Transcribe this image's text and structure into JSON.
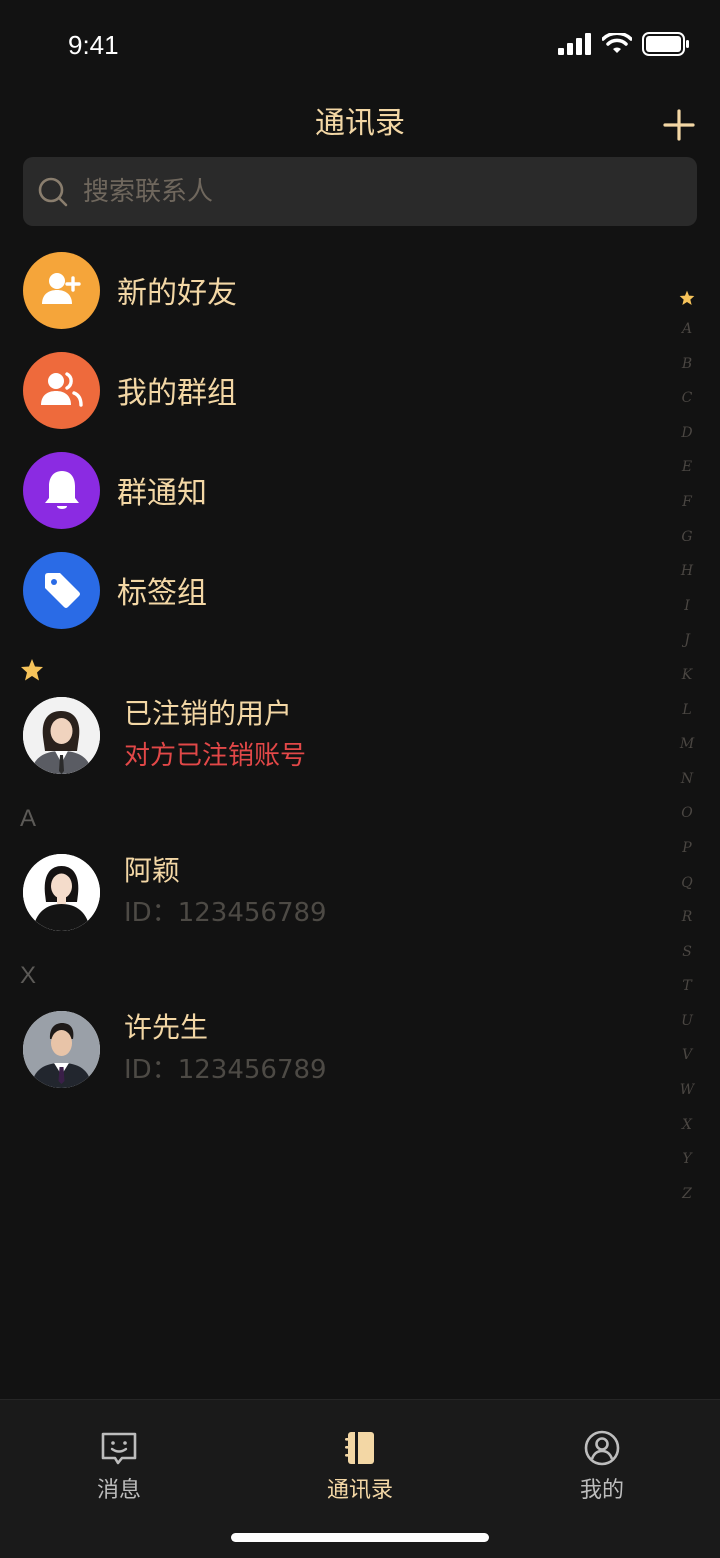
{
  "status": {
    "time": "9:41"
  },
  "header": {
    "title": "通讯录"
  },
  "search": {
    "placeholder": "搜索联系人"
  },
  "menu": [
    {
      "label": "新的好友",
      "color": "#F5A53A",
      "icon": "add-friend-icon"
    },
    {
      "label": "我的群组",
      "color": "#EE6A3C",
      "icon": "group-icon"
    },
    {
      "label": "群通知",
      "color": "#8B2BE2",
      "icon": "bell-icon"
    },
    {
      "label": "标签组",
      "color": "#2A6BE6",
      "icon": "tag-icon"
    }
  ],
  "sections": {
    "star": "★",
    "a": "A",
    "x": "X"
  },
  "contacts": [
    {
      "name": "已注销的用户",
      "sub": "对方已注销账号",
      "status": "deactivated"
    },
    {
      "name": "阿颖",
      "sub": "ID：123456789"
    },
    {
      "name": "许先生",
      "sub": "ID：123456789"
    }
  ],
  "index": [
    "A",
    "B",
    "C",
    "D",
    "E",
    "F",
    "G",
    "H",
    "I",
    "J",
    "K",
    "L",
    "M",
    "N",
    "O",
    "P",
    "Q",
    "R",
    "S",
    "T",
    "U",
    "V",
    "W",
    "X",
    "Y",
    "Z"
  ],
  "tabs": [
    {
      "label": "消息",
      "icon": "message-icon",
      "active": false
    },
    {
      "label": "通讯录",
      "icon": "contacts-book-icon",
      "active": true
    },
    {
      "label": "我的",
      "icon": "profile-icon",
      "active": false
    }
  ],
  "colors": {
    "accent": "#F3D7A5",
    "star": "#F6C35A",
    "warn": "#E24848",
    "background": "#121212"
  }
}
